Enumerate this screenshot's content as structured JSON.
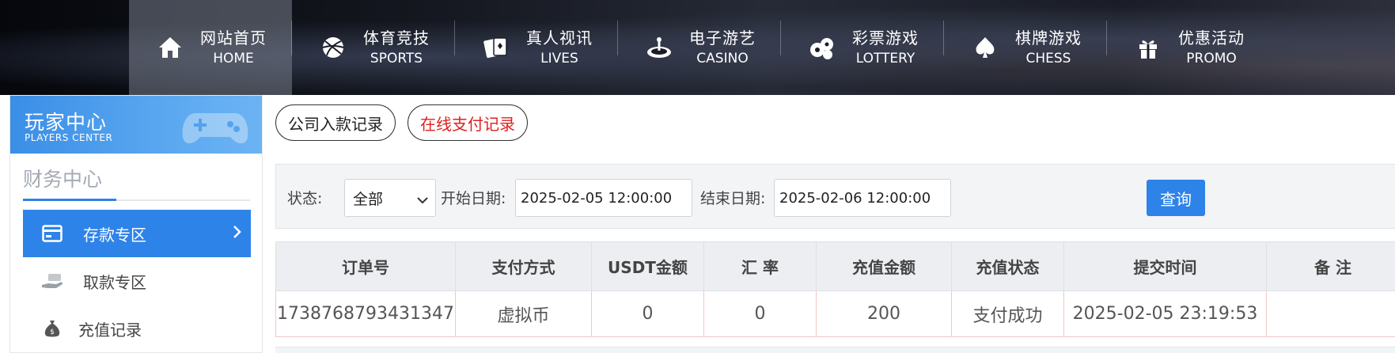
{
  "nav": {
    "items": [
      {
        "cn": "网站首页",
        "en": "HOME",
        "icon": "home-icon"
      },
      {
        "cn": "体育竞技",
        "en": "SPORTS",
        "icon": "ball-icon"
      },
      {
        "cn": "真人视讯",
        "en": "LIVES",
        "icon": "cards-icon"
      },
      {
        "cn": "电子游艺",
        "en": "CASINO",
        "icon": "roulette-icon"
      },
      {
        "cn": "彩票游戏",
        "en": "LOTTERY",
        "icon": "lottery-balls-icon"
      },
      {
        "cn": "棋牌游戏",
        "en": "CHESS",
        "icon": "spade-icon"
      },
      {
        "cn": "优惠活动",
        "en": "PROMO",
        "icon": "gift-icon"
      }
    ]
  },
  "sidebar": {
    "title_cn": "玩家中心",
    "title_en": "PLAYERS CENTER",
    "section": "财务中心",
    "items": [
      {
        "label": "存款专区",
        "icon": "deposit-card-icon"
      },
      {
        "label": "取款专区",
        "icon": "withdraw-hand-icon"
      },
      {
        "label": "充值记录",
        "icon": "money-bag-icon"
      }
    ]
  },
  "tabs": {
    "company": "公司入款记录",
    "online": "在线支付记录"
  },
  "filter": {
    "status_label": "状态:",
    "status_value": "全部",
    "start_label": "开始日期:",
    "start_value": "2025-02-05 12:00:00",
    "end_label": "结束日期:",
    "end_value": "2025-02-06 12:00:00",
    "query_label": "查询"
  },
  "table": {
    "headers": [
      "订单号",
      "支付方式",
      "USDT金额",
      "汇 率",
      "充值金额",
      "充值状态",
      "提交时间",
      "备 注"
    ],
    "rows": [
      [
        "1738768793431347",
        "虚拟币",
        "0",
        "0",
        "200",
        "支付成功",
        "2025-02-05 23:19:53",
        ""
      ]
    ]
  },
  "colors": {
    "accent": "#2e83e8",
    "online_tab_text": "#e02020"
  }
}
